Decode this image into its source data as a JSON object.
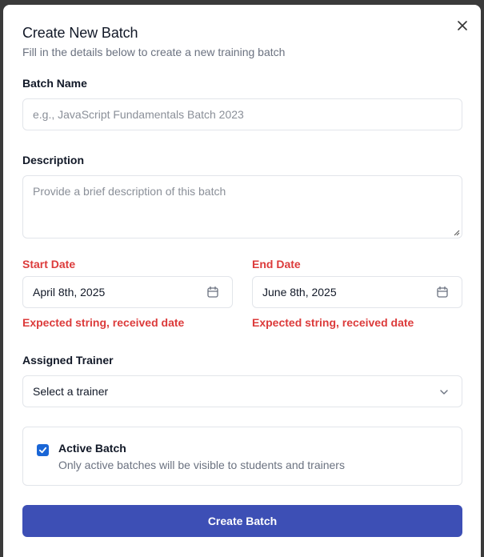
{
  "dialog": {
    "title": "Create New Batch",
    "subtitle": "Fill in the details below to create a new training batch",
    "close_icon": "close-icon"
  },
  "fields": {
    "batch_name": {
      "label": "Batch Name",
      "value": "",
      "placeholder": "e.g., JavaScript Fundamentals Batch 2023"
    },
    "description": {
      "label": "Description",
      "value": "",
      "placeholder": "Provide a brief description of this batch"
    },
    "start_date": {
      "label": "Start Date",
      "value": "April 8th, 2025",
      "error": "Expected string, received date",
      "icon": "calendar-icon"
    },
    "end_date": {
      "label": "End Date",
      "value": "June 8th, 2025",
      "error": "Expected string, received date",
      "icon": "calendar-icon"
    },
    "trainer": {
      "label": "Assigned Trainer",
      "value": "Select a trainer",
      "icon": "chevron-down-icon"
    },
    "active": {
      "label": "Active Batch",
      "description": "Only active batches will be visible to students and trainers",
      "checked": true
    }
  },
  "actions": {
    "submit_label": "Create Batch"
  },
  "colors": {
    "accent": "#3d4fb5",
    "error": "#dc3b3b",
    "checkbox": "#1a66d6"
  }
}
